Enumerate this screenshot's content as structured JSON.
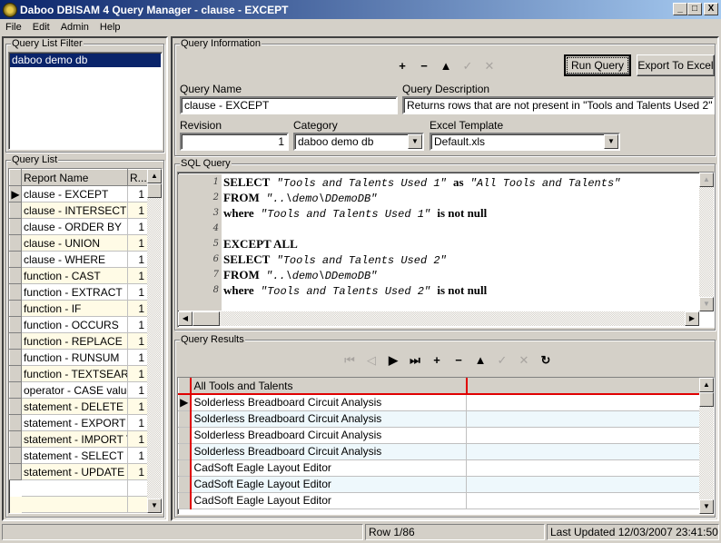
{
  "window": {
    "title": "Daboo DBISAM 4 Query Manager - clause - EXCEPT",
    "minimize": "_",
    "maximize": "□",
    "close": "X"
  },
  "menu": [
    "File",
    "Edit",
    "Admin",
    "Help"
  ],
  "query_list_filter": {
    "label": "Query List Filter",
    "items": [
      {
        "label": "daboo demo db",
        "selected": true
      }
    ]
  },
  "query_list": {
    "label": "Query List",
    "columns": [
      "Report Name",
      "R..."
    ],
    "rows": [
      {
        "name": "clause - EXCEPT",
        "rev": "1",
        "current": true
      },
      {
        "name": "clause - INTERSECT",
        "rev": "1"
      },
      {
        "name": "clause - ORDER BY",
        "rev": "1"
      },
      {
        "name": "clause - UNION",
        "rev": "1"
      },
      {
        "name": "clause - WHERE",
        "rev": "1"
      },
      {
        "name": "function - CAST",
        "rev": "1"
      },
      {
        "name": "function - EXTRACT",
        "rev": "1"
      },
      {
        "name": "function - IF",
        "rev": "1"
      },
      {
        "name": "function - OCCURS",
        "rev": "1"
      },
      {
        "name": "function - REPLACE",
        "rev": "1"
      },
      {
        "name": "function - RUNSUM",
        "rev": "1"
      },
      {
        "name": "function - TEXTSEARCI",
        "rev": "1"
      },
      {
        "name": "operator - CASE value",
        "rev": "1"
      },
      {
        "name": "statement - DELETE",
        "rev": "1"
      },
      {
        "name": "statement - EXPORT TA",
        "rev": "1"
      },
      {
        "name": "statement - IMPORT TA",
        "rev": "1"
      },
      {
        "name": "statement - SELECT",
        "rev": "1"
      },
      {
        "name": "statement - UPDATE",
        "rev": "1"
      }
    ]
  },
  "query_info": {
    "label": "Query Information",
    "toolbar": [
      {
        "icon": "plus-icon",
        "glyph": "+",
        "enabled": true
      },
      {
        "icon": "minus-icon",
        "glyph": "−",
        "enabled": true
      },
      {
        "icon": "up-triangle-icon",
        "glyph": "▲",
        "enabled": true
      },
      {
        "icon": "check-icon",
        "glyph": "✓",
        "enabled": false
      },
      {
        "icon": "cancel-icon",
        "glyph": "✕",
        "enabled": false
      }
    ],
    "run_query": "Run Query",
    "export_excel": "Export To Excel",
    "query_name_label": "Query Name",
    "query_name": "clause - EXCEPT",
    "query_desc_label": "Query Description",
    "query_desc": "Returns rows that are not present in \"Tools and Talents Used 2\"",
    "revision_label": "Revision",
    "revision": "1",
    "category_label": "Category",
    "category": "daboo demo db",
    "excel_template_label": "Excel Template",
    "excel_template": "Default.xls"
  },
  "sql_query": {
    "label": "SQL Query",
    "lines": [
      {
        "n": "1",
        "tokens": [
          {
            "t": "SELECT",
            "k": "kw"
          },
          {
            "t": " \"Tools and Talents Used 1\" ",
            "k": "str"
          },
          {
            "t": "as",
            "k": "kw"
          },
          {
            "t": " \"All Tools and Talents\"",
            "k": "str"
          }
        ]
      },
      {
        "n": "2",
        "tokens": [
          {
            "t": "FROM",
            "k": "kw"
          },
          {
            "t": " \"..\\demo\\DDemoDB\"",
            "k": "str"
          }
        ]
      },
      {
        "n": "3",
        "tokens": [
          {
            "t": "where",
            "k": "kw"
          },
          {
            "t": " \"Tools and Talents Used 1\" ",
            "k": "str"
          },
          {
            "t": "is not null",
            "k": "kw"
          }
        ]
      },
      {
        "n": "4",
        "tokens": []
      },
      {
        "n": "5",
        "tokens": [
          {
            "t": "EXCEPT ALL",
            "k": "kw"
          }
        ]
      },
      {
        "n": "6",
        "tokens": [
          {
            "t": "SELECT",
            "k": "kw"
          },
          {
            "t": " \"Tools and Talents Used 2\"",
            "k": "str"
          }
        ]
      },
      {
        "n": "7",
        "tokens": [
          {
            "t": "FROM",
            "k": "kw"
          },
          {
            "t": " \"..\\demo\\DDemoDB\"",
            "k": "str"
          }
        ]
      },
      {
        "n": "8",
        "tokens": [
          {
            "t": "where",
            "k": "kw"
          },
          {
            "t": " \"Tools and Talents Used 2\" ",
            "k": "str"
          },
          {
            "t": "is not null",
            "k": "kw"
          }
        ]
      }
    ]
  },
  "query_results": {
    "label": "Query Results",
    "navigator": [
      {
        "icon": "first-record-icon",
        "glyph": "⏮",
        "enabled": false
      },
      {
        "icon": "prior-record-icon",
        "glyph": "◁",
        "enabled": false
      },
      {
        "icon": "next-record-icon",
        "glyph": "▶",
        "enabled": true
      },
      {
        "icon": "last-record-icon",
        "glyph": "⏭",
        "enabled": true
      },
      {
        "icon": "plus-icon",
        "glyph": "+",
        "enabled": true
      },
      {
        "icon": "minus-icon",
        "glyph": "−",
        "enabled": true
      },
      {
        "icon": "up-triangle-icon",
        "glyph": "▲",
        "enabled": true
      },
      {
        "icon": "check-icon",
        "glyph": "✓",
        "enabled": false
      },
      {
        "icon": "cancel-icon",
        "glyph": "✕",
        "enabled": false
      },
      {
        "icon": "refresh-icon",
        "glyph": "↻",
        "enabled": true
      }
    ],
    "columns": [
      "All Tools and Talents",
      ""
    ],
    "rows": [
      "Solderless Breadboard Circuit Analysis",
      "Solderless Breadboard Circuit Analysis",
      "Solderless Breadboard Circuit Analysis",
      "Solderless Breadboard Circuit Analysis",
      "CadSoft Eagle Layout Editor",
      "CadSoft Eagle Layout Editor",
      "CadSoft Eagle Layout Editor"
    ]
  },
  "status": {
    "left": "",
    "row": "Row 1/86",
    "updated": "Last Updated 12/03/2007 23:41:50"
  }
}
